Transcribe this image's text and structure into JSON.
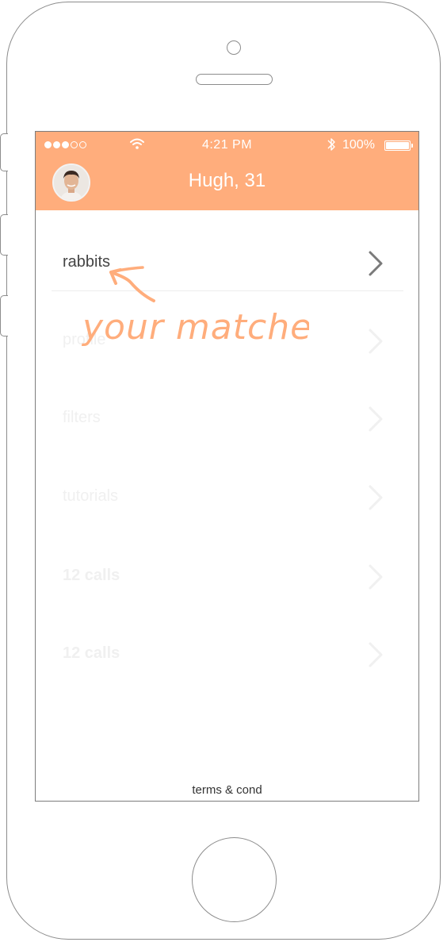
{
  "status_bar": {
    "time": "4:21 PM",
    "battery_percent": "100%",
    "signal_dots": 5,
    "signal_filled": 3
  },
  "header": {
    "title": "Hugh, 31",
    "background_color": "#ffad7c"
  },
  "menu": {
    "items": [
      {
        "label": "rabbits",
        "state": "active"
      },
      {
        "label": "profile",
        "state": "faded"
      },
      {
        "label": "filters",
        "state": "faded"
      },
      {
        "label": "tutorials",
        "state": "faded"
      },
      {
        "label": "12 calls",
        "state": "faded-bold"
      },
      {
        "label": "12 calls",
        "state": "faded-bold"
      }
    ]
  },
  "annotation": {
    "text": "your matches",
    "color": "#ffad7c"
  },
  "footer": {
    "terms_label": "terms & cond"
  },
  "icons": [
    "wifi-icon",
    "bluetooth-icon",
    "battery-icon",
    "chevron-right-icon",
    "avatar",
    "arrow-annotation-icon"
  ]
}
